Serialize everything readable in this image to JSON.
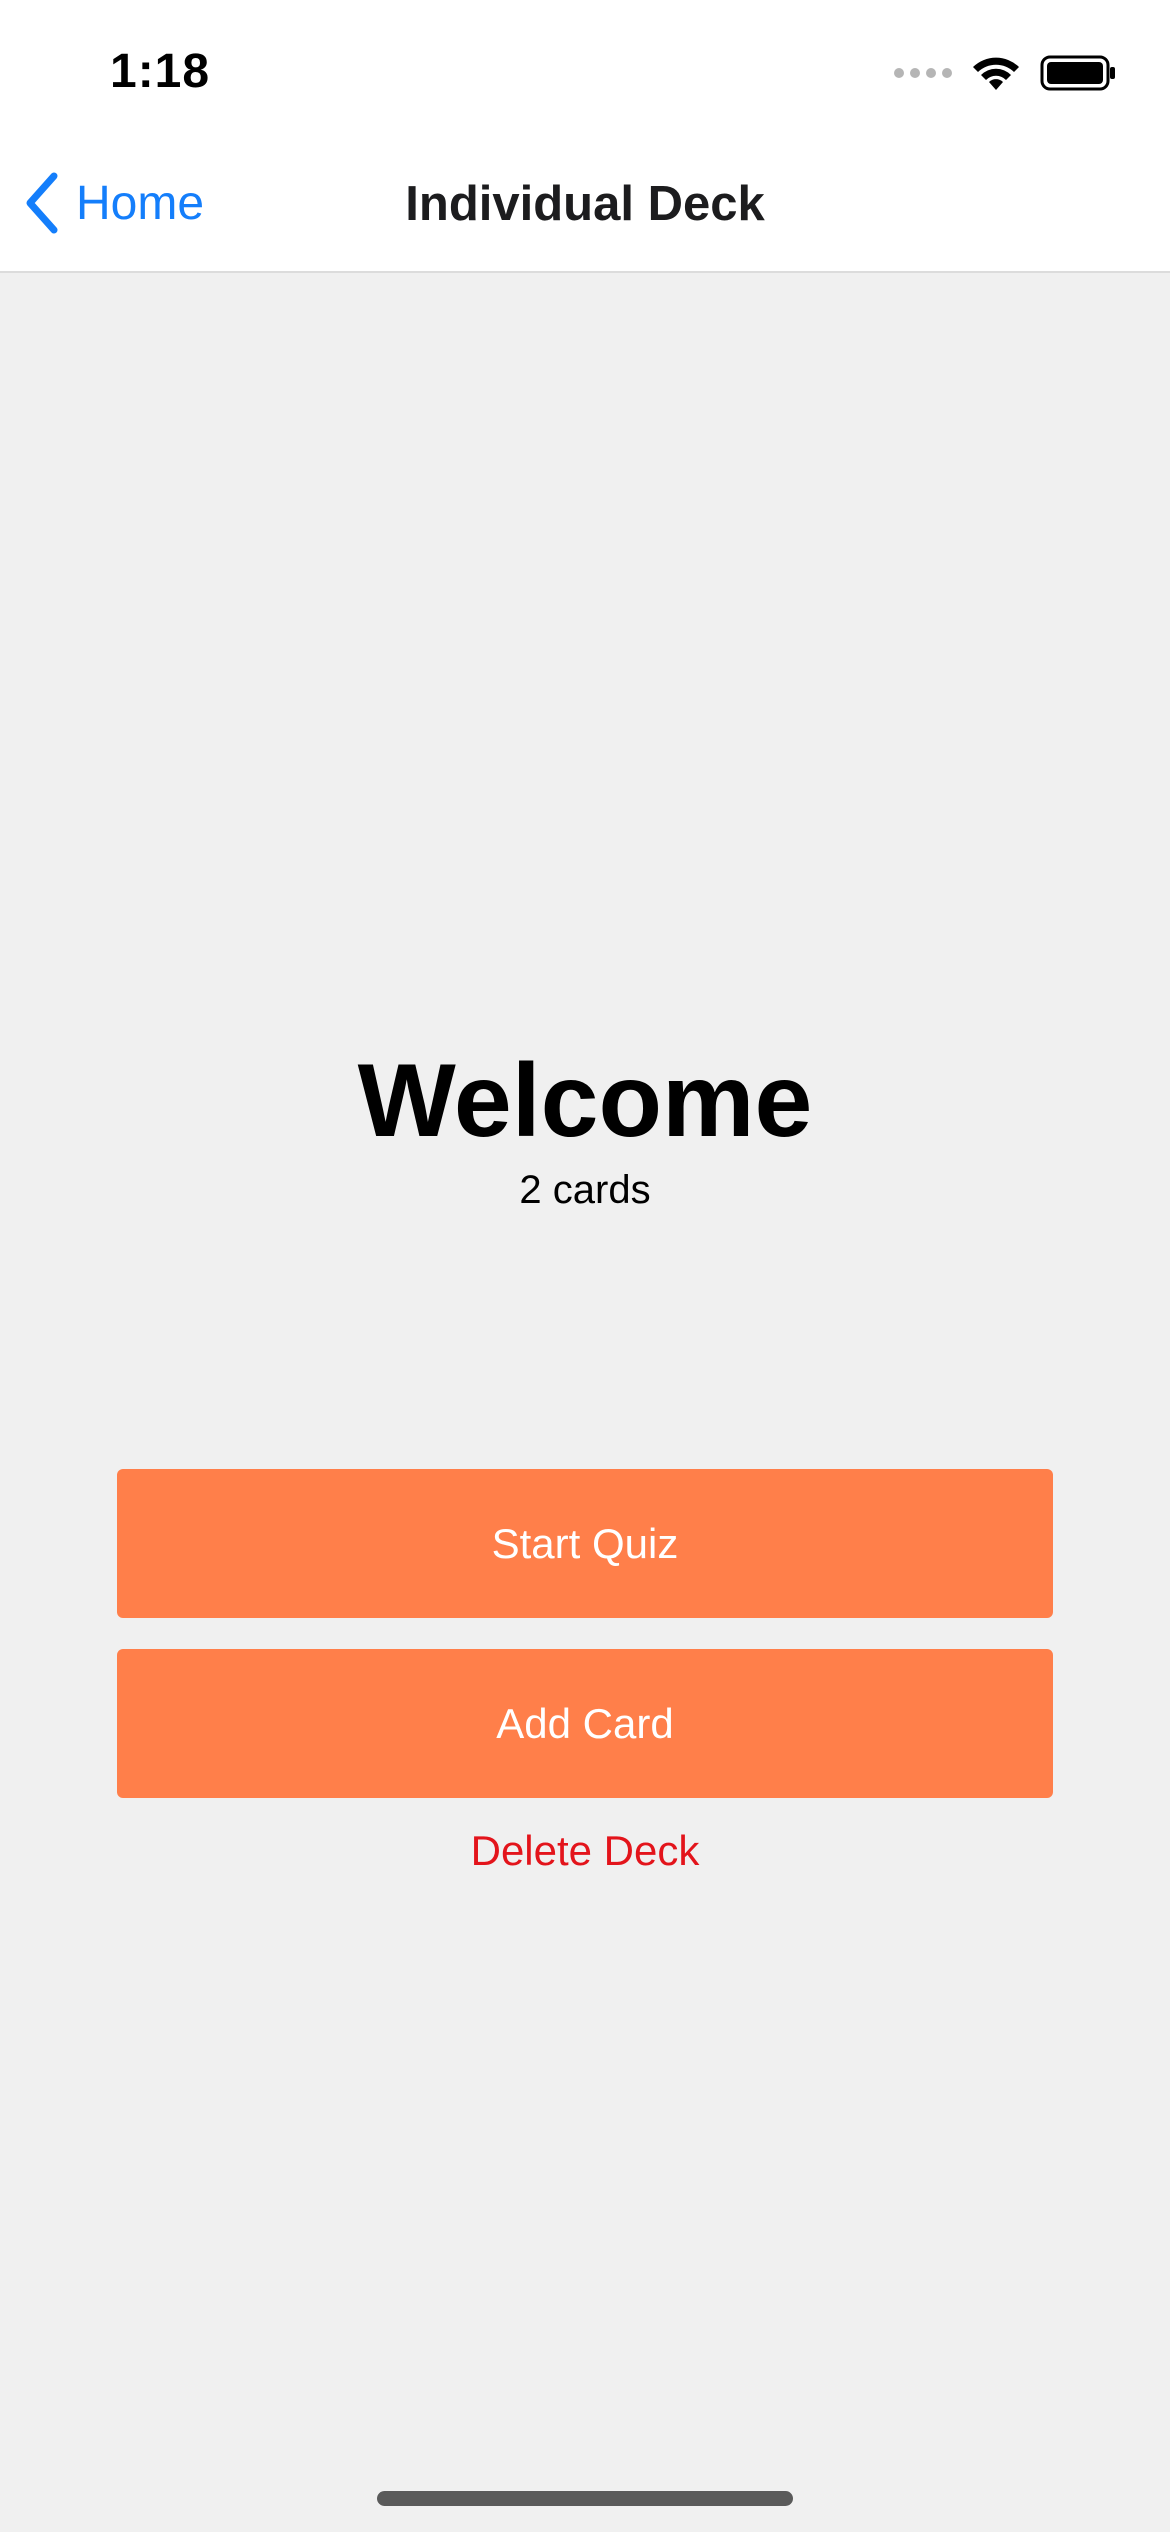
{
  "status_bar": {
    "time": "1:18"
  },
  "nav": {
    "back_label": "Home",
    "title": "Individual Deck"
  },
  "deck": {
    "title": "Welcome",
    "card_count": "2 cards"
  },
  "actions": {
    "start_quiz": "Start Quiz",
    "add_card": "Add Card",
    "delete_deck": "Delete Deck"
  },
  "colors": {
    "accent": "#ff7f4a",
    "link": "#147efb",
    "danger": "#e3141b",
    "background": "#f0f0f0"
  }
}
